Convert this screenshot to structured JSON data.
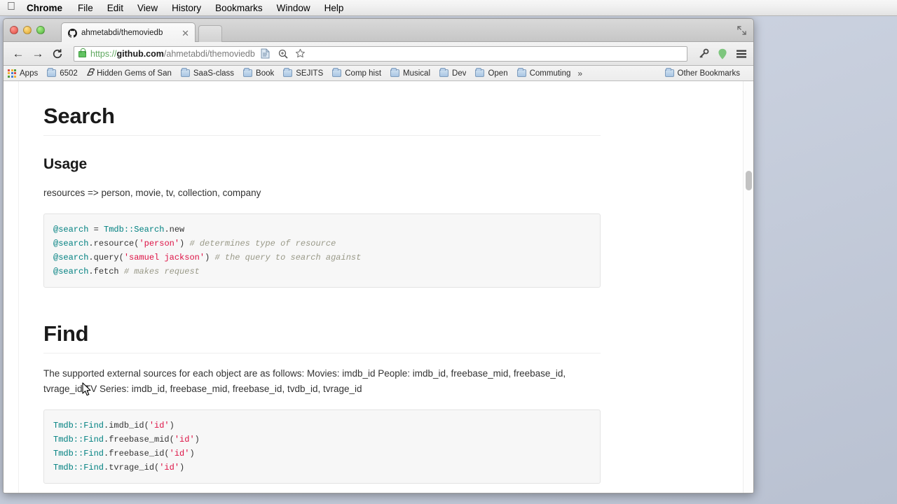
{
  "menubar": {
    "apple": "apple-logo",
    "items": [
      {
        "label": "Chrome",
        "bold": true
      },
      {
        "label": "File",
        "bold": false
      },
      {
        "label": "Edit",
        "bold": false
      },
      {
        "label": "View",
        "bold": false
      },
      {
        "label": "History",
        "bold": false
      },
      {
        "label": "Bookmarks",
        "bold": false
      },
      {
        "label": "Window",
        "bold": false
      },
      {
        "label": "Help",
        "bold": false
      }
    ]
  },
  "window": {
    "fullscreen_icon": "fullscreen-arrows-icon",
    "tab": {
      "title": "ahmetabdi/themoviedb",
      "favicon": "github-octocat-icon",
      "close_icon": "close-icon"
    }
  },
  "toolbar": {
    "back_icon": "back-arrow-icon",
    "forward_icon": "forward-arrow-icon",
    "reload_icon": "reload-icon",
    "lock_icon": "lock-icon",
    "url": {
      "full": "https://github.com/ahmetabdi/themoviedb",
      "scheme": "https://",
      "host": "github.com",
      "path": "/ahmetabdi/themoviedb"
    },
    "icons": [
      {
        "name": "page-document-icon",
        "glyph": "▤"
      },
      {
        "name": "zoom-magnifier-icon",
        "glyph": "⌕"
      },
      {
        "name": "bookmark-star-icon",
        "glyph": "☆"
      },
      {
        "name": "extension-key-icon",
        "glyph": "⚷"
      },
      {
        "name": "location-pin-icon",
        "glyph": "⬤"
      },
      {
        "name": "chrome-menu-icon",
        "glyph": "≡"
      }
    ]
  },
  "bookmarks": {
    "apps_label": "Apps",
    "apps_colors": [
      "#e04c3f",
      "#f2b235",
      "#4f9b3a",
      "#f2b235",
      "#4a80d0",
      "#e04c3f",
      "#4f9b3a",
      "#4a80d0",
      "#f2b235"
    ],
    "items": [
      {
        "label": "6502",
        "icon": "folder-icon"
      },
      {
        "label": "Hidden Gems of San",
        "icon": "script-b-icon"
      },
      {
        "label": "SaaS-class",
        "icon": "folder-icon"
      },
      {
        "label": "Book",
        "icon": "folder-icon"
      },
      {
        "label": "SEJITS",
        "icon": "folder-icon"
      },
      {
        "label": "Comp hist",
        "icon": "folder-icon"
      },
      {
        "label": "Musical",
        "icon": "folder-icon"
      },
      {
        "label": "Dev",
        "icon": "folder-icon"
      },
      {
        "label": "Open",
        "icon": "folder-icon"
      },
      {
        "label": "Commuting",
        "icon": "folder-icon"
      }
    ],
    "overflow_label": "»",
    "other_label": "Other Bookmarks"
  },
  "page": {
    "search_heading": "Search",
    "usage_heading": "Usage",
    "resources_line": "resources => person, movie, tv, collection, company",
    "code_search": [
      [
        {
          "t": "@search",
          "c": "k-var"
        },
        {
          "t": " = ",
          "c": "k-pln"
        },
        {
          "t": "Tmdb::Search",
          "c": "k-cls"
        },
        {
          "t": ".new",
          "c": "k-pln"
        }
      ],
      [
        {
          "t": "@search",
          "c": "k-var"
        },
        {
          "t": ".resource(",
          "c": "k-pln"
        },
        {
          "t": "'person'",
          "c": "k-str"
        },
        {
          "t": ") ",
          "c": "k-pln"
        },
        {
          "t": "# determines type of resource",
          "c": "k-com"
        }
      ],
      [
        {
          "t": "@search",
          "c": "k-var"
        },
        {
          "t": ".query(",
          "c": "k-pln"
        },
        {
          "t": "'samuel jackson'",
          "c": "k-str"
        },
        {
          "t": ") ",
          "c": "k-pln"
        },
        {
          "t": "# the query to search against",
          "c": "k-com"
        }
      ],
      [
        {
          "t": "@search",
          "c": "k-var"
        },
        {
          "t": ".fetch ",
          "c": "k-pln"
        },
        {
          "t": "# makes request",
          "c": "k-com"
        }
      ]
    ],
    "find_heading": "Find",
    "find_paragraph": "The supported external sources for each object are as follows: Movies: imdb_id People: imdb_id, freebase_mid, freebase_id, tvrage_id TV Series: imdb_id, freebase_mid, freebase_id, tvdb_id, tvrage_id",
    "code_find": [
      [
        {
          "t": "Tmdb::Find",
          "c": "k-cls"
        },
        {
          "t": ".imdb_id(",
          "c": "k-pln"
        },
        {
          "t": "'id'",
          "c": "k-str"
        },
        {
          "t": ")",
          "c": "k-pln"
        }
      ],
      [
        {
          "t": "Tmdb::Find",
          "c": "k-cls"
        },
        {
          "t": ".freebase_mid(",
          "c": "k-pln"
        },
        {
          "t": "'id'",
          "c": "k-str"
        },
        {
          "t": ")",
          "c": "k-pln"
        }
      ],
      [
        {
          "t": "Tmdb::Find",
          "c": "k-cls"
        },
        {
          "t": ".freebase_id(",
          "c": "k-pln"
        },
        {
          "t": "'id'",
          "c": "k-str"
        },
        {
          "t": ")",
          "c": "k-pln"
        }
      ],
      [
        {
          "t": "Tmdb::Find",
          "c": "k-cls"
        },
        {
          "t": ".tvrage_id(",
          "c": "k-pln"
        },
        {
          "t": "'id'",
          "c": "k-str"
        },
        {
          "t": ")",
          "c": "k-pln"
        }
      ]
    ]
  },
  "scrollbars": {
    "vertical_thumb": "vertical-scrollbar-thumb",
    "horizontal_thumb": "horizontal-scrollbar-thumb"
  },
  "colors": {
    "accent_green": "#63c363",
    "code_bg": "#f7f7f7",
    "string": "#d14",
    "class": "#008080",
    "comment": "#998"
  }
}
